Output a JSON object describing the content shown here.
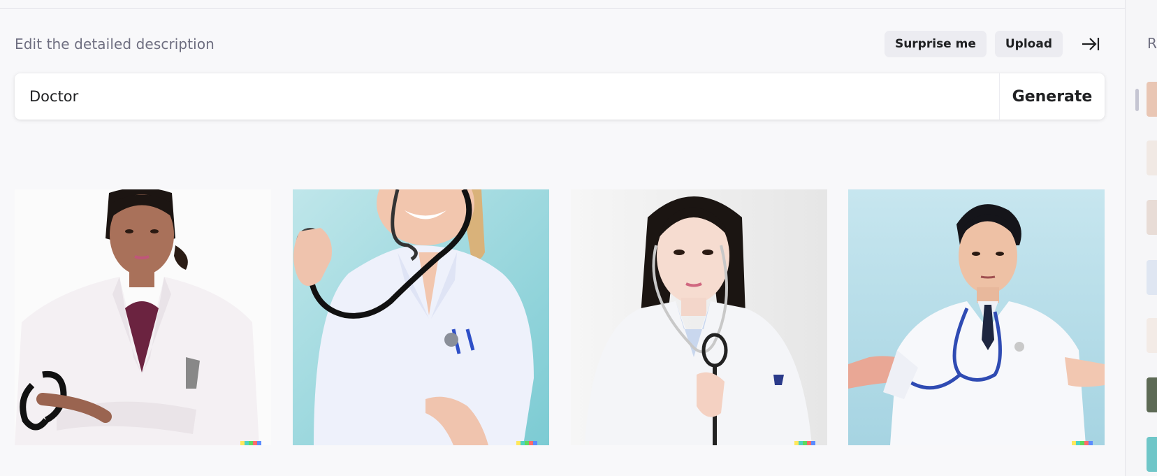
{
  "header": {
    "description_label": "Edit the detailed description",
    "surprise_label": "Surprise me",
    "upload_label": "Upload"
  },
  "prompt": {
    "value": "Doctor",
    "generate_label": "Generate"
  },
  "results": [
    {
      "subject": "woman doctor, white coat, stethoscope, white background"
    },
    {
      "subject": "smiling doctor holding stethoscope, teal background"
    },
    {
      "subject": "young doctor with stethoscope, light background"
    },
    {
      "subject": "male doctor with arms outstretched, light blue background"
    }
  ],
  "history": {
    "label": "R"
  },
  "colors": {
    "accent": "#202123",
    "background": "#f8f8fa",
    "pill": "#ececf1"
  }
}
